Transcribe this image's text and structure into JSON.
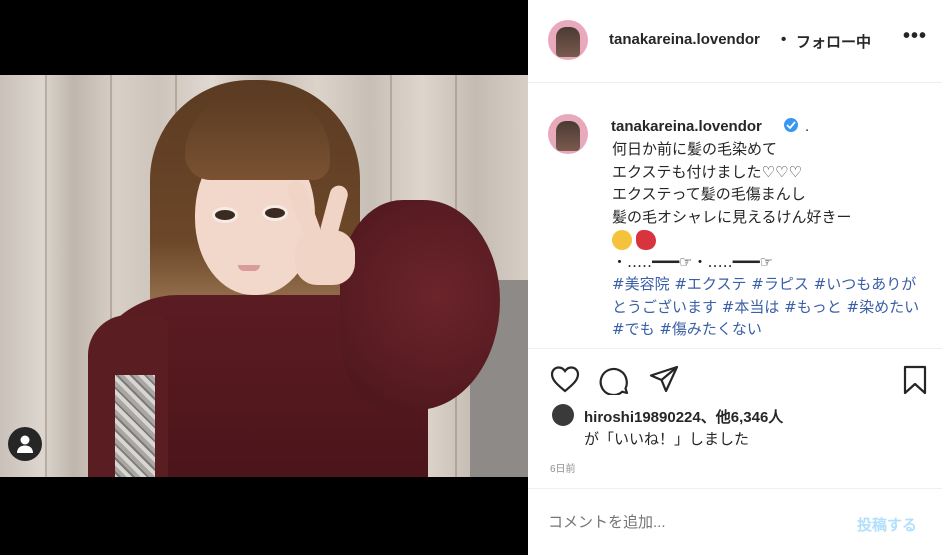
{
  "post": {
    "username": "tanakareina.lovendor",
    "separator": "•",
    "follow_status": "フォロー中",
    "more_label": "•••"
  },
  "caption": {
    "username": "tanakareina.lovendor",
    "dot": ".",
    "lines": [
      "何日か前に髪の毛染めて",
      "エクステも付けました♡♡♡",
      "エクステって髪の毛傷まんし",
      "髪の毛オシャレに見えるけん好きー",
      "・‥…━━━☞・‥…━━━☞"
    ],
    "hashtags": [
      "#美容院",
      "#エクステ",
      "#ラピス",
      "#いつもありがとうございます",
      "#本当は",
      "#もっと",
      "#染めたい",
      "#でも",
      "#傷みたくない"
    ]
  },
  "likes": {
    "user": "hiroshi19890224",
    "others": "、他6,346人",
    "suffix": "が「いいね！」しました"
  },
  "timestamp": "6日前",
  "comment": {
    "placeholder": "コメントを追加...",
    "post_label": "投稿する"
  },
  "colors": {
    "verified": "#3897f0",
    "hashtag": "#3a5fa6",
    "post_button": "#b2dffc"
  },
  "icons": [
    "heart-icon",
    "comment-icon",
    "share-icon",
    "bookmark-icon",
    "user-tag-icon",
    "verified-badge-icon"
  ]
}
